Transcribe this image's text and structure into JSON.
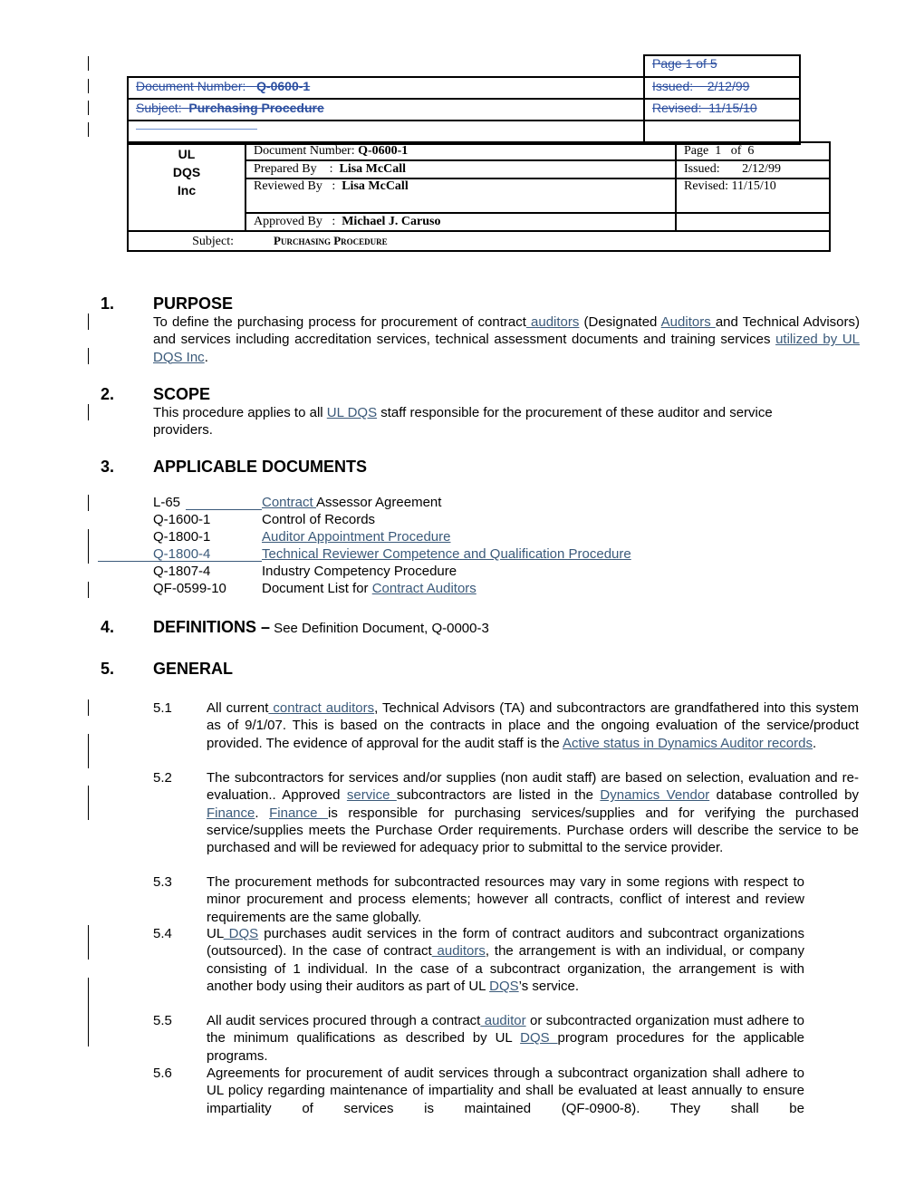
{
  "old_header": {
    "page": "Page  1 of 5",
    "document_number_label": "Document Number:",
    "document_number": "Q-0600-1",
    "issued": "Issued:    2/12/99",
    "subject_label": "Subject:",
    "subject": "Purchasing Procedure",
    "revised": "Revised:  11/15/10"
  },
  "header": {
    "logo_lines": [
      "UL",
      "DQS",
      "Inc"
    ],
    "document_number_label": "Document Number: ",
    "document_number": "Q-0600-1",
    "prepared_label": "Prepared By    :  ",
    "prepared_by": "Lisa McCall",
    "reviewed_label": "Reviewed By   :  ",
    "reviewed_by": "Lisa McCall",
    "approved_label": "Approved By   :  ",
    "approved_by": "Michael J. Caruso",
    "page": "Page  1   of  6",
    "issued": "Issued:       2/12/99",
    "revised": "Revised: 11/15/10",
    "subject_label": "Subject:",
    "subject": "Purchasing Procedure"
  },
  "sections": {
    "s1": {
      "num": "1.",
      "title": "PURPOSE"
    },
    "s2": {
      "num": "2.",
      "title": "SCOPE"
    },
    "s3": {
      "num": "3.",
      "title": "APPLICABLE DOCUMENTS"
    },
    "s4": {
      "num": "4.",
      "title": "DEFINITIONS –",
      "suffix": " See Definition Document, Q-0000-3"
    },
    "s5": {
      "num": "5.",
      "title": "GENERAL"
    }
  },
  "purpose": {
    "t1": "To define the purchasing process for procurement of contract",
    "l1": " auditors",
    "t2": " (Designated ",
    "l2": "Auditors ",
    "t3": "and Technical Advisors) and services including accreditation services, technical assessment documents and training services ",
    "l3": " utilized by UL DQS Inc",
    "t4": "."
  },
  "scope": {
    "t1": "This procedure applies to all ",
    "l1": "UL DQS",
    "t2": " staff responsible for the procurement of these auditor and service providers."
  },
  "documents": [
    {
      "code": "L-65",
      "title_link": "Contract ",
      "title": "Assessor Agreement"
    },
    {
      "code": "Q-1600-1",
      "title": "Control of Records"
    },
    {
      "code": "Q-1800-1",
      "title_link": "Auditor Appointment Procedure"
    },
    {
      "code": "Q-1800-4",
      "title_link": "Technical Reviewer Competence and Qualification Procedure"
    },
    {
      "code": "Q-1807-4",
      "title": "Industry Competency Procedure"
    },
    {
      "code": "QF-0599-10",
      "title": "Document List for ",
      "title_link2": "Contract Auditors"
    }
  ],
  "general": {
    "i51": {
      "num": "5.1",
      "a": "All current",
      "b": " contract auditors",
      "c": ", Technical Advisors (TA) and subcontractors are grandfathered into this system as of 9/1/07. This is based on the contracts in place and the ongoing evaluation of the service/product provided. The evidence of approval for the audit staff  is the ",
      "d": " Active status in Dynamics Auditor records",
      "e": "."
    },
    "i52": {
      "num": "5.2",
      "a": "The subcontractors for services and/or supplies (non audit staff) are based on selection, evaluation and re-evaluation.. Approved ",
      "b": "service ",
      "c": "subcontractors are listed in the ",
      "d": "Dynamics Vendor",
      "e": " database controlled by ",
      "f": "Finance",
      "g": ". ",
      "h": "Finance ",
      "i": " is responsible for purchasing services/supplies and for verifying the purchased service/supplies meets the Purchase Order requirements. Purchase orders will describe the service to be purchased and will be reviewed for adequacy prior to submittal to the service provider."
    },
    "i53": {
      "num": "5.3",
      "a": "The procurement methods for subcontracted resources may vary in some regions with respect to minor procurement and process elements; however all contracts, conflict of interest and review requirements are the same globally."
    },
    "i54": {
      "num": "5.4",
      "a": "UL",
      "b": " DQS",
      "c": " purchases audit services in the form of contract auditors and subcontract organizations (outsourced).  In the case of contract",
      "d": " auditors",
      "e": ", the arrangement is with an individual, or company consisting of 1 individual.  In the case of a subcontract organization, the arrangement is with another body using their auditors as part of UL ",
      "f": "DQS",
      "g": "’s service."
    },
    "i55": {
      "num": "5.5",
      "a": "All audit services procured through a contract",
      "b": " auditor",
      "c": " or subcontracted organization must adhere to the minimum qualifications as described by UL ",
      "d": "DQS ",
      "e": "program procedures for the applicable programs."
    },
    "i56": {
      "num": "5.6",
      "a": "Agreements for procurement of audit services through a subcontract organization shall adhere to UL policy regarding maintenance of impartiality and shall be evaluated at least annually to ensure impartiality of services is maintained (QF-0900-8).  They shall be"
    }
  }
}
